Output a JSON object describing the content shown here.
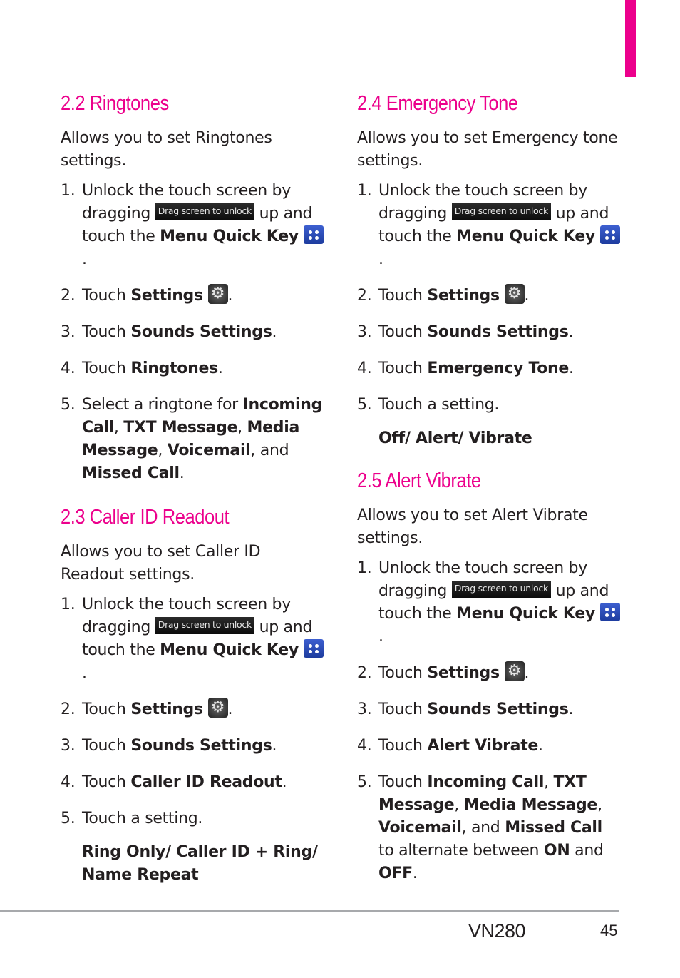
{
  "page": {
    "model": "VN280",
    "number": "45",
    "accent_color": "#ec008c"
  },
  "badge_text": "Drag screen to unlock",
  "sections": {
    "ringtones": {
      "title": "2.2 Ringtones",
      "desc": "Allows you to set Ringtones settings.",
      "steps": {
        "s1": {
          "num": "1.",
          "a": "Unlock the touch screen by dragging",
          "b": "up and touch the",
          "c": "Menu Quick Key",
          "d": "."
        },
        "s2": {
          "num": "2.",
          "a": "Touch",
          "b": "Settings",
          "c": "."
        },
        "s3": {
          "num": "3.",
          "a": "Touch",
          "b": "Sounds Settings",
          "c": "."
        },
        "s4": {
          "num": "4.",
          "a": "Touch",
          "b": "Ringtones",
          "c": "."
        },
        "s5": {
          "num": "5.",
          "a": "Select a ringtone for",
          "b": "Incoming Call",
          "c": ",",
          "d": "TXT Message",
          "e": ",",
          "f": "Media Message",
          "g": ",",
          "h": "Voicemail",
          "i": ", and",
          "j": "Missed Call",
          "k": "."
        }
      }
    },
    "caller_id": {
      "title": "2.3 Caller ID Readout",
      "desc": "Allows you to set Caller ID Readout settings.",
      "steps": {
        "s1": {
          "num": "1.",
          "a": "Unlock the touch screen by dragging",
          "b": "up and touch the",
          "c": "Menu Quick Key",
          "d": "."
        },
        "s2": {
          "num": "2.",
          "a": "Touch",
          "b": "Settings",
          "c": "."
        },
        "s3": {
          "num": "3.",
          "a": "Touch",
          "b": "Sounds Settings",
          "c": "."
        },
        "s4": {
          "num": "4.",
          "a": "Touch",
          "b": "Caller ID Readout",
          "c": "."
        },
        "s5": {
          "num": "5.",
          "a": "Touch a setting."
        }
      },
      "options": "Ring Only/ Caller ID + Ring/ Name Repeat"
    },
    "emergency": {
      "title": "2.4 Emergency Tone",
      "desc": "Allows you to set Emergency tone settings.",
      "steps": {
        "s1": {
          "num": "1.",
          "a": "Unlock the touch screen by dragging",
          "b": "up and touch the",
          "c": "Menu Quick Key",
          "d": "."
        },
        "s2": {
          "num": "2.",
          "a": "Touch",
          "b": "Settings",
          "c": "."
        },
        "s3": {
          "num": "3.",
          "a": "Touch",
          "b": "Sounds Settings",
          "c": "."
        },
        "s4": {
          "num": "4.",
          "a": "Touch",
          "b": "Emergency Tone",
          "c": "."
        },
        "s5": {
          "num": "5.",
          "a": "Touch a setting."
        }
      },
      "options": "Off/ Alert/ Vibrate"
    },
    "alert_vibrate": {
      "title": "2.5 Alert Vibrate",
      "desc": "Allows you to set Alert Vibrate settings.",
      "steps": {
        "s1": {
          "num": "1.",
          "a": "Unlock the touch screen by dragging",
          "b": "up and touch the",
          "c": "Menu Quick Key",
          "d": "."
        },
        "s2": {
          "num": "2.",
          "a": "Touch",
          "b": "Settings",
          "c": "."
        },
        "s3": {
          "num": "3.",
          "a": "Touch",
          "b": "Sounds Settings",
          "c": "."
        },
        "s4": {
          "num": "4.",
          "a": "Touch",
          "b": "Alert Vibrate",
          "c": "."
        },
        "s5": {
          "num": "5.",
          "a": "Touch",
          "b": "Incoming Call",
          "c": ",",
          "d": "TXT Message",
          "e": ",",
          "f": "Media Message",
          "g": ",",
          "h": "Voicemail",
          "i": ", and",
          "j": "Missed Call",
          "k": "to alternate between",
          "l": "ON",
          "m": "and",
          "n": "OFF",
          "o": "."
        }
      }
    }
  }
}
